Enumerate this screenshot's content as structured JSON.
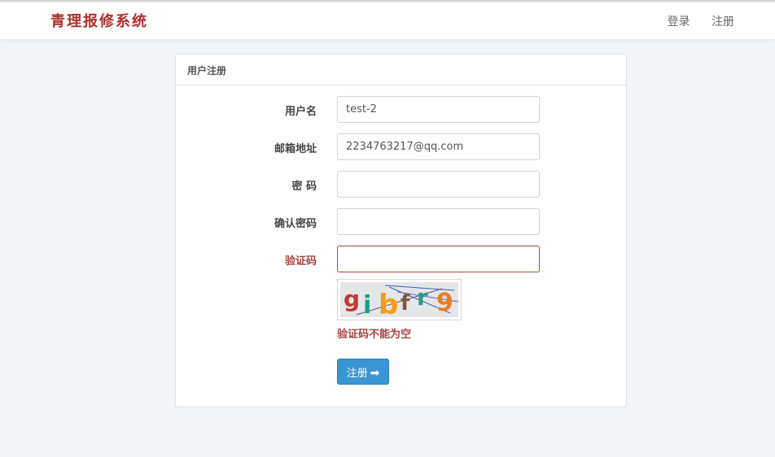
{
  "navbar": {
    "brand": "青理报修系统",
    "login_label": "登录",
    "register_label": "注册"
  },
  "panel": {
    "title": "用户注册"
  },
  "form": {
    "username": {
      "label": "用户名",
      "value": "test-2"
    },
    "email": {
      "label": "邮箱地址",
      "value": "2234763217@qq.com"
    },
    "password": {
      "label": "密 码",
      "value": ""
    },
    "confirm": {
      "label": "确认密码",
      "value": ""
    },
    "captcha": {
      "label": "验证码",
      "value": "",
      "image_text": "gibfr9",
      "error": "验证码不能为空"
    },
    "submit_label": "注册",
    "submit_icon": "arrow-right-icon"
  },
  "colors": {
    "brand": "#b0302c",
    "error": "#a94442",
    "primary": "#3a96d2"
  }
}
